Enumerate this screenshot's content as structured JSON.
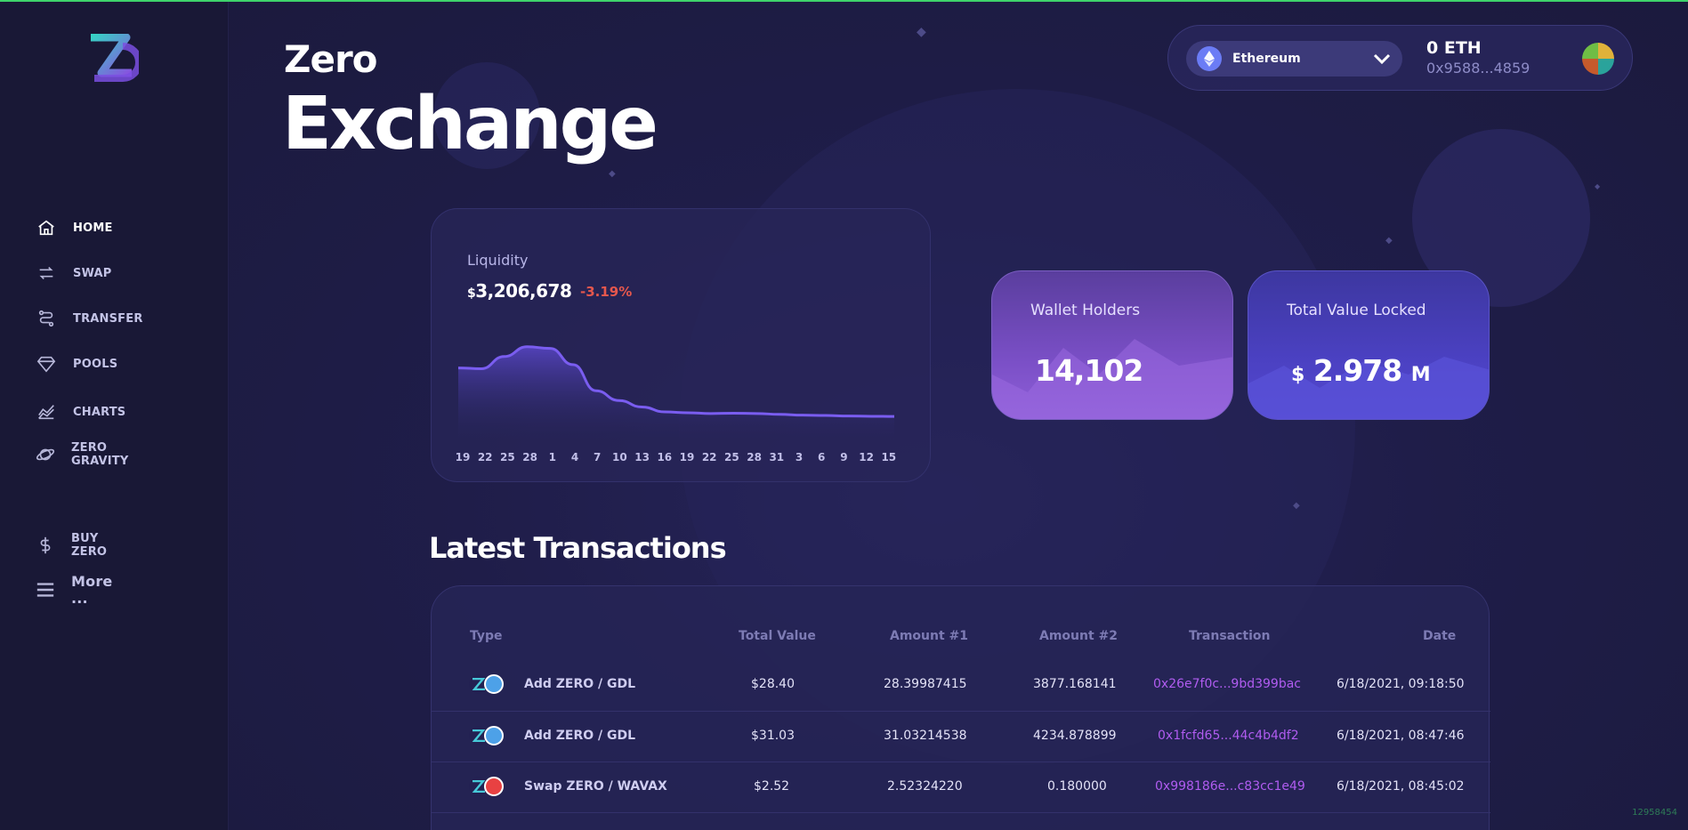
{
  "brand": {
    "name": "Zero",
    "colors": {
      "accent": "#7a4fc6",
      "link": "#b05cf0",
      "negative": "#e5574d",
      "topline": "#3ed36b"
    }
  },
  "hero": {
    "small": "Zero",
    "big": "Exchange"
  },
  "sidebar": {
    "items": [
      {
        "label": "HOME",
        "icon": "home-icon",
        "active": true
      },
      {
        "label": "SWAP",
        "icon": "swap-icon"
      },
      {
        "label": "TRANSFER",
        "icon": "transfer-icon"
      },
      {
        "label": "POOLS",
        "icon": "diamond-icon"
      },
      {
        "label": "CHARTS",
        "icon": "chart-icon"
      },
      {
        "label": "ZERO GRAVITY",
        "icon": "planet-icon"
      },
      {
        "label": "BUY ZERO",
        "icon": "dollar-icon"
      },
      {
        "label": "More ...",
        "icon": "menu-icon"
      }
    ]
  },
  "wallet": {
    "network": "Ethereum",
    "balance": "0 ETH",
    "address": "0x9588...4859"
  },
  "liquidity": {
    "title": "Liquidity",
    "currency": "$",
    "value": "3,206,678",
    "change": "-3.19%"
  },
  "chart_data": {
    "type": "area",
    "title": "Liquidity",
    "x": [
      "19",
      "22",
      "25",
      "28",
      "1",
      "4",
      "7",
      "10",
      "13",
      "16",
      "19",
      "22",
      "25",
      "28",
      "31",
      "3",
      "6",
      "9",
      "12",
      "15"
    ],
    "values": [
      3.9,
      3.85,
      4.6,
      5.2,
      5.1,
      4.1,
      2.5,
      1.9,
      1.5,
      1.2,
      1.15,
      1.1,
      1.12,
      1.1,
      1.05,
      1.0,
      0.98,
      0.95,
      0.93,
      0.92
    ],
    "grid": false
  },
  "stats": {
    "wallet_holders": {
      "label": "Wallet Holders",
      "value": "14,102"
    },
    "tvl": {
      "label": "Total Value Locked",
      "currency": "$",
      "value": "2.978",
      "unit": "M"
    }
  },
  "transactions": {
    "title": "Latest Transactions",
    "columns": [
      "Type",
      "Total Value",
      "Amount #1",
      "Amount #2",
      "Transaction",
      "Date"
    ],
    "rows": [
      {
        "type": "Add ZERO / GDL",
        "total": "$28.40",
        "a1": "28.39987415",
        "a2": "3877.168141",
        "tx": "0x26e7f0c...9bd399bac",
        "date": "6/18/2021, 09:18:50",
        "token": "gdl"
      },
      {
        "type": "Add ZERO / GDL",
        "total": "$31.03",
        "a1": "31.03214538",
        "a2": "4234.878899",
        "tx": "0x1fcfd65...44c4b4df2",
        "date": "6/18/2021, 08:47:46",
        "token": "gdl"
      },
      {
        "type": "Swap ZERO / WAVAX",
        "total": "$2.52",
        "a1": "2.52324220",
        "a2": "0.180000",
        "tx": "0x998186e...c83cc1e49",
        "date": "6/18/2021, 08:45:02",
        "token": "avax"
      }
    ]
  },
  "corner": "12958454"
}
